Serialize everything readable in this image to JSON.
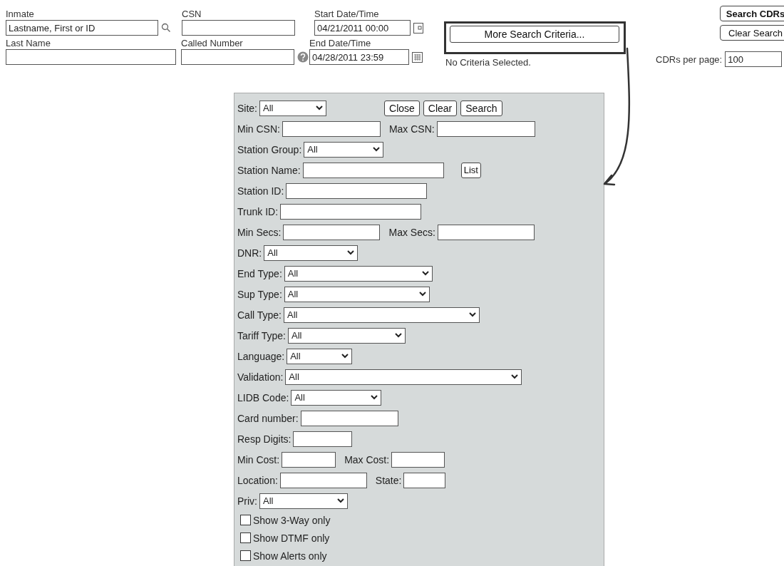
{
  "search_form": {
    "inmate": {
      "label": "Inmate",
      "placeholder": "Lastname, First or ID"
    },
    "csn": {
      "label": "CSN"
    },
    "start": {
      "label": "Start Date/Time",
      "value": "04/21/2011 00:00"
    },
    "last_name": {
      "label": "Last Name"
    },
    "called_number": {
      "label": "Called Number"
    },
    "end": {
      "label": "End Date/Time",
      "value": "04/28/2011 23:59"
    },
    "more_button": "More Search Criteria...",
    "criteria_status": "No Criteria Selected.",
    "buttons": [
      "Search CDRs",
      "Clear Search"
    ],
    "per_page": {
      "label": "CDRs per page:",
      "value": "100"
    }
  },
  "criteria_panel": {
    "buttons": [
      "Close",
      "Clear",
      "Search"
    ],
    "rows": [
      {
        "fields": [
          {
            "kind": "select",
            "label": "Site:",
            "value": "All"
          }
        ]
      },
      {
        "fields": [
          {
            "kind": "input",
            "label": "Min CSN:"
          },
          {
            "kind": "input",
            "label": "Max CSN:"
          }
        ]
      },
      {
        "fields": [
          {
            "kind": "select",
            "label": "Station Group:",
            "value": "All"
          }
        ]
      },
      {
        "fields": [
          {
            "kind": "input",
            "label": "Station Name:"
          },
          {
            "kind": "button",
            "label": "List"
          }
        ]
      },
      {
        "fields": [
          {
            "kind": "input",
            "label": "Station ID:"
          }
        ]
      },
      {
        "fields": [
          {
            "kind": "input",
            "label": "Trunk ID:"
          }
        ]
      },
      {
        "fields": [
          {
            "kind": "input",
            "label": "Min Secs:"
          },
          {
            "kind": "input",
            "label": "Max Secs:"
          }
        ]
      },
      {
        "fields": [
          {
            "kind": "select",
            "label": "DNR:",
            "value": "All"
          }
        ]
      },
      {
        "fields": [
          {
            "kind": "select",
            "label": "End Type:",
            "value": "All"
          }
        ]
      },
      {
        "fields": [
          {
            "kind": "select",
            "label": "Sup Type:",
            "value": "All"
          }
        ]
      },
      {
        "fields": [
          {
            "kind": "select",
            "label": "Call Type:",
            "value": "All"
          }
        ]
      },
      {
        "fields": [
          {
            "kind": "select",
            "label": "Tariff Type:",
            "value": "All"
          }
        ]
      },
      {
        "fields": [
          {
            "kind": "select",
            "label": "Language:",
            "value": "All"
          }
        ]
      },
      {
        "fields": [
          {
            "kind": "select",
            "label": "Validation:",
            "value": "All"
          }
        ]
      },
      {
        "fields": [
          {
            "kind": "select",
            "label": "LIDB Code:",
            "value": "All"
          }
        ]
      },
      {
        "fields": [
          {
            "kind": "input",
            "label": "Card number:"
          }
        ]
      },
      {
        "fields": [
          {
            "kind": "input",
            "label": "Resp Digits:"
          }
        ]
      },
      {
        "fields": [
          {
            "kind": "input",
            "label": "Min Cost:"
          },
          {
            "kind": "input",
            "label": "Max Cost:"
          }
        ]
      },
      {
        "fields": [
          {
            "kind": "input",
            "label": "Location:"
          },
          {
            "kind": "input",
            "label": "State:"
          }
        ]
      },
      {
        "fields": [
          {
            "kind": "select",
            "label": "Priv:",
            "value": "All"
          }
        ]
      }
    ],
    "checkboxes": [
      {
        "label": "Show 3-Way only",
        "checked": false
      },
      {
        "label": "Show DTMF only",
        "checked": false
      },
      {
        "label": "Show Alerts only",
        "checked": false
      }
    ]
  }
}
